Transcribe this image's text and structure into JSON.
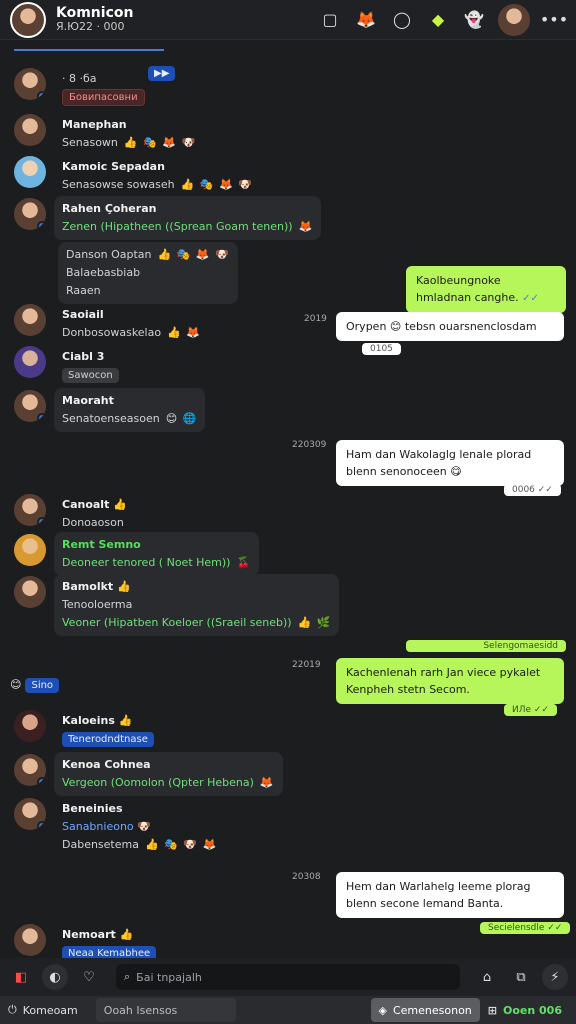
{
  "header": {
    "title": "Komnicon",
    "subtitle": "Я.Ю22 · 000",
    "icons": [
      "square-icon",
      "fox-icon",
      "circle-icon",
      "lime-brand-icon",
      "ghost-icon"
    ]
  },
  "messages": [
    {
      "name": "",
      "chip": "· 8 ·ба",
      "chip_color": "blue",
      "sub_chip": "Бовипасовни",
      "sub_chip_style": "red"
    },
    {
      "name": "Manephan",
      "text": "Senasown",
      "emojis": "👍 🎭 🦊 🐶"
    },
    {
      "name": "Kamoic Sepadan",
      "text": "Senasowse sowaseh",
      "emojis": "👍 🎭 🦊 🐶"
    },
    {
      "name": "Rahen Çoheran",
      "text": "Zenen (Hipatheen ((Sprean Goam tenen))",
      "emojis": "🦊"
    },
    {
      "name": "Danson Oaptan",
      "text": "Balaebasbiab",
      "text2": "Raaen",
      "emojis": "👍 🎭 🦊 🐶"
    },
    {
      "name": "Saoiail",
      "text": "Donbosowaskelao",
      "emojis": "👍 🦊"
    },
    {
      "name": "Ciabl 3",
      "chip": "Sawocon"
    },
    {
      "name": "Maoraht",
      "text": "Senatoenseasoen",
      "emojis": "😊 🌐"
    },
    {
      "name": "Canoalt 👍",
      "text": "Donoaoson"
    },
    {
      "name": "Remt Semno",
      "text": "Deoneer tenored ( Noet Hem))",
      "emojis": "🍒"
    },
    {
      "name": "Bamolkt 👍",
      "text": "Tenooloerma",
      "text2": "Veoner (Hipatben Koeloer ((Sraeil seneb))",
      "emojis": "👍 🌿"
    },
    {
      "name": "",
      "chip": "Sino",
      "chip_color": "blue"
    },
    {
      "name": "Kaloeins 👍",
      "chip": "Tenerodndtnase"
    },
    {
      "name": "Kenoa Cohnea",
      "text": "Vergeon (Oomolon (Qpter Hebena)",
      "emojis": "🦊"
    },
    {
      "name": "Beneinies",
      "text": "Sanabnieono 🐶",
      "text2": "Dabensetema",
      "emojis": "👍 🎭 🐶 🦊"
    },
    {
      "name": "Nemoart 👍",
      "chip": "Neaa Kemabhee"
    }
  ],
  "outgoing": [
    {
      "text": "Kaolbeungnoke hmladnan canghe.",
      "style": "green",
      "time": "2019"
    },
    {
      "text": "Orypen 😊 tebsn ouarsnenclosdam",
      "style": "white",
      "meta": "0105"
    },
    {
      "text": "Ham dan Wakolaglg lenale plorad blenn senonoceen 😋",
      "style": "white",
      "time": "220309",
      "meta": "0006 ✓✓"
    },
    {
      "text": "Kachenlenah rarh Jan viece pykalet Kenpheh stetn Secom.",
      "style": "green",
      "time": "22019",
      "meta_top": "Selengomaesidd",
      "meta": "ИЛе ✓✓"
    },
    {
      "text": "Hem dan Warlahelg leeme plorag blenn secone lemand Banta.",
      "style": "white",
      "time": "20308",
      "meta": "Secielensdle ✓✓"
    }
  ],
  "compose": {
    "search_placeholder": "Бai tnpajalh"
  },
  "bottom_bar": {
    "tab1": "Komeoam",
    "tab2": "Ooah Isensos",
    "tab3": "Cemenesonon",
    "tab4": "Ooen 006"
  },
  "colors": {
    "accent_green": "#b7f65b",
    "chip_blue": "#1e4fb5",
    "chip_red_text": "#f08e8e",
    "name_green": "#53e05a"
  }
}
